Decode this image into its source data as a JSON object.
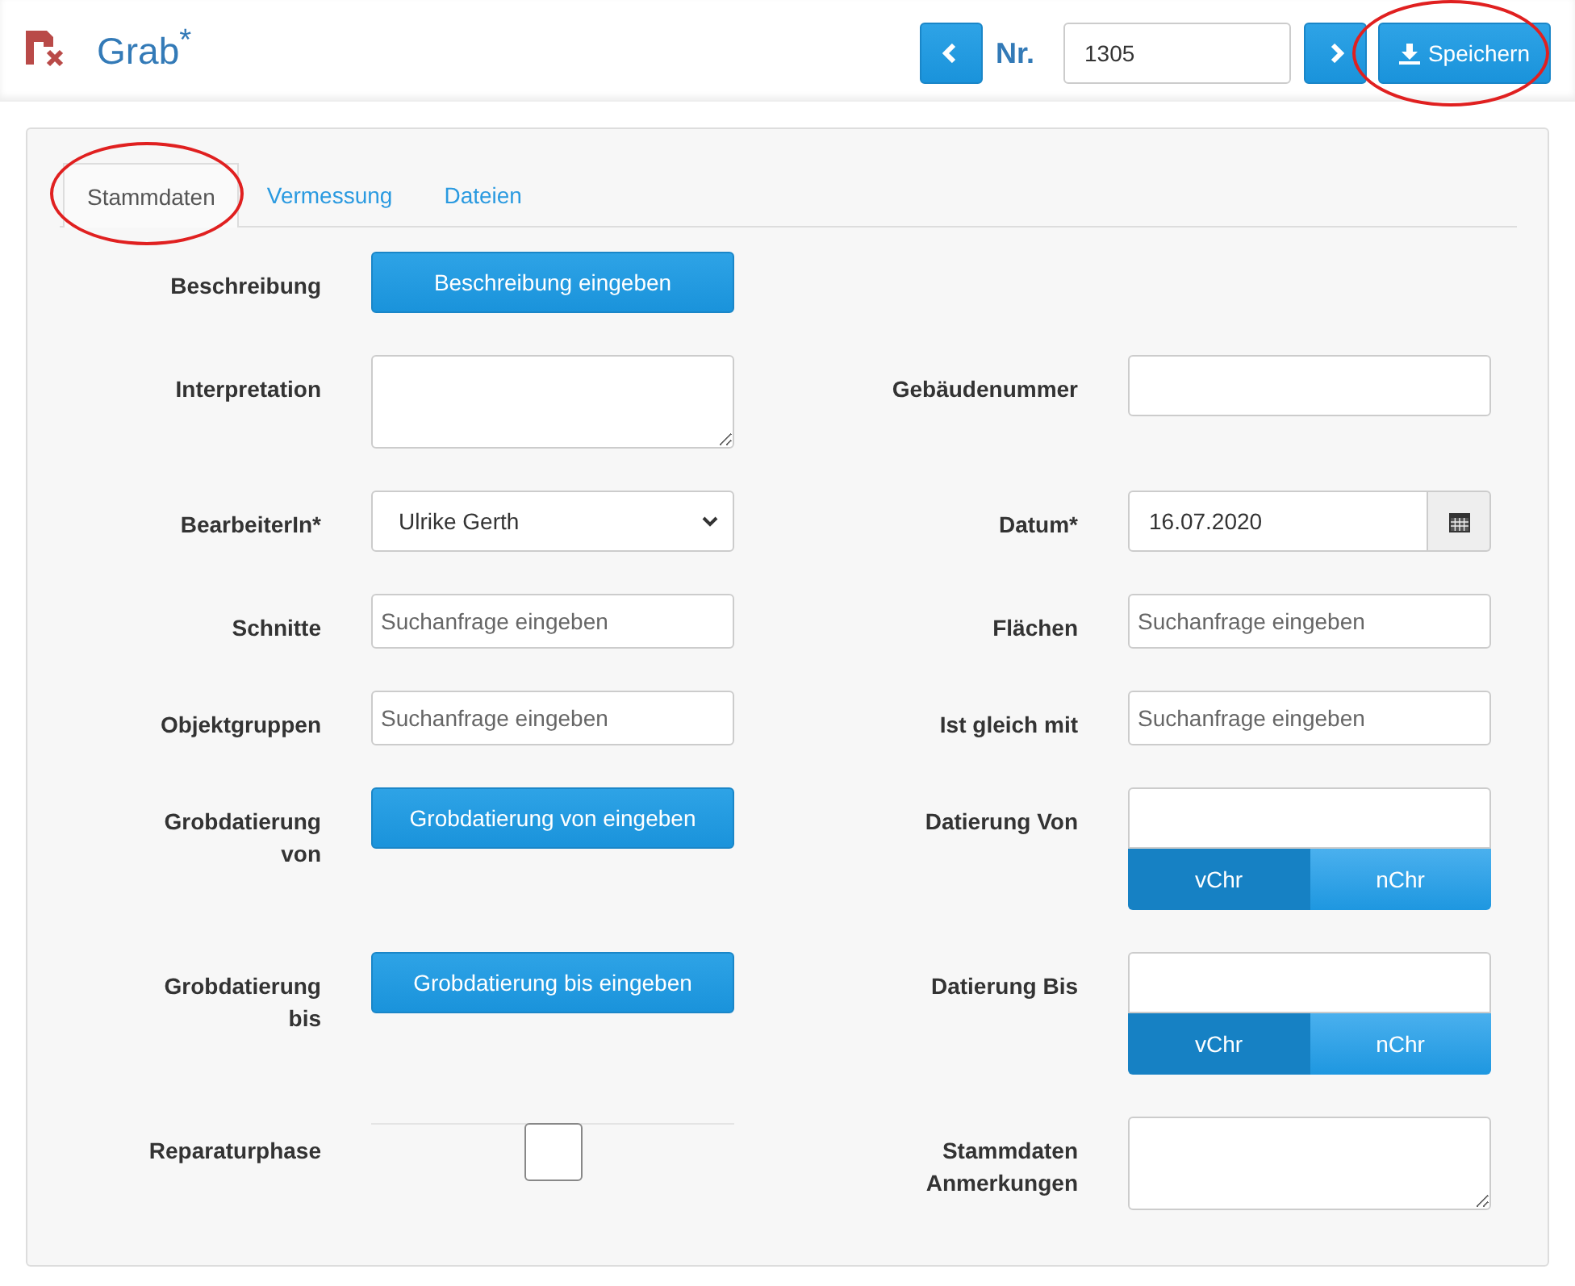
{
  "header": {
    "title": "Grab$^{*}$",
    "number_label": "Nr.",
    "number_value": "1305",
    "save_button": {
      "label": "Speichern",
      "circled": true
    }
  },
  "tabs": [
    {
      "label": "Stammdaten",
      "selected": true,
      "circled": true
    },
    {
      "label": "Vermessung",
      "selected": false,
      "circled": false
    },
    {
      "label": "Dateien",
      "selected": false,
      "circled": false
    }
  ],
  "rows": [
    {
      "left": {
        "label": "Beschreibung",
        "kind": "button",
        "text": "Beschreibung eingeben"
      }
    },
    {
      "left": {
        "label": "Interpretation",
        "kind": "textarea"
      },
      "right": {
        "label": "Gebäudenummer",
        "kind": "text"
      }
    },
    {
      "left": {
        "label": "BearbeiterIn*",
        "kind": "select",
        "value": "Ulrike Gerth"
      },
      "right": {
        "label": "Datum*",
        "kind": "date",
        "value": "16.07.2020"
      }
    },
    {
      "left": {
        "label": "Schnitte",
        "kind": "search",
        "placeholder": "Suchanfrage eingeben"
      },
      "right": {
        "label": "Flächen",
        "kind": "search",
        "placeholder": "Suchanfrage eingeben"
      }
    },
    {
      "left": {
        "label": "Objektgruppen",
        "kind": "search",
        "placeholder": "Suchanfrage eingeben"
      },
      "right": {
        "label": "Ist gleich mit",
        "kind": "search",
        "placeholder": "Suchanfrage eingeben"
      }
    },
    {
      "left": {
        "label": "Grobdatierung von",
        "kind": "button",
        "text": "Grobdatierung von eingeben"
      },
      "right": {
        "label": "Datierung Von",
        "kind": "era",
        "era": [
          {
            "label": "vChr",
            "selected": true
          },
          {
            "label": "nChr",
            "selected": false
          }
        ]
      }
    },
    {
      "left": {
        "label": "Grobdatierung bis",
        "kind": "button",
        "text": "Grobdatierung bis eingeben"
      },
      "right": {
        "label": "Datierung Bis",
        "kind": "era",
        "era": [
          {
            "label": "vChr",
            "selected": true
          },
          {
            "label": "nChr",
            "selected": false
          }
        ]
      }
    },
    {
      "left": {
        "label": "Reparaturphase",
        "kind": "checkbox",
        "checked": false
      },
      "right": {
        "label": "Stammdaten Anmerkungen",
        "kind": "textarea"
      }
    }
  ]
}
